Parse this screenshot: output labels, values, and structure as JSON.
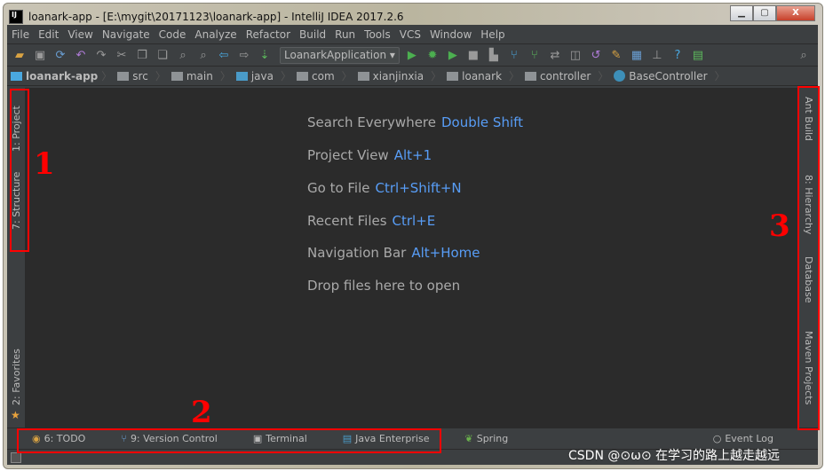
{
  "window": {
    "title": "loanark-app - [E:\\mygit\\20171123\\loanark-app] - IntelliJ IDEA 2017.2.6",
    "icon": "IJ"
  },
  "menu": [
    "File",
    "Edit",
    "View",
    "Navigate",
    "Code",
    "Analyze",
    "Refactor",
    "Build",
    "Run",
    "Tools",
    "VCS",
    "Window",
    "Help"
  ],
  "toolbar": {
    "run_config": "LoanarkApplication"
  },
  "breadcrumb": [
    "loanark-app",
    "src",
    "main",
    "java",
    "com",
    "xianjinxia",
    "loanark",
    "controller",
    "BaseController"
  ],
  "left_tools": {
    "project": "1: Project",
    "structure": "7: Structure",
    "favorites": "2: Favorites"
  },
  "right_tools": {
    "ant": "Ant Build",
    "hierarchy": "8: Hierarchy",
    "database": "Database",
    "maven": "Maven Projects"
  },
  "hints": [
    {
      "label": "Search Everywhere",
      "key": "Double Shift"
    },
    {
      "label": "Project View",
      "key": "Alt+1"
    },
    {
      "label": "Go to File",
      "key": "Ctrl+Shift+N"
    },
    {
      "label": "Recent Files",
      "key": "Ctrl+E"
    },
    {
      "label": "Navigation Bar",
      "key": "Alt+Home"
    },
    {
      "label": "Drop files here to open",
      "key": ""
    }
  ],
  "bottom_tools": [
    "6: TODO",
    "9: Version Control",
    "Terminal",
    "Java Enterprise",
    "Spring"
  ],
  "event_log": "Event Log",
  "annotations": [
    "1",
    "2",
    "3"
  ],
  "watermark": "CSDN @⊙ω⊙ 在学习的路上越走越远",
  "colors": {
    "accent": "#589df6",
    "annotation": "#ff0000",
    "editor_bg": "#2b2b2b"
  }
}
